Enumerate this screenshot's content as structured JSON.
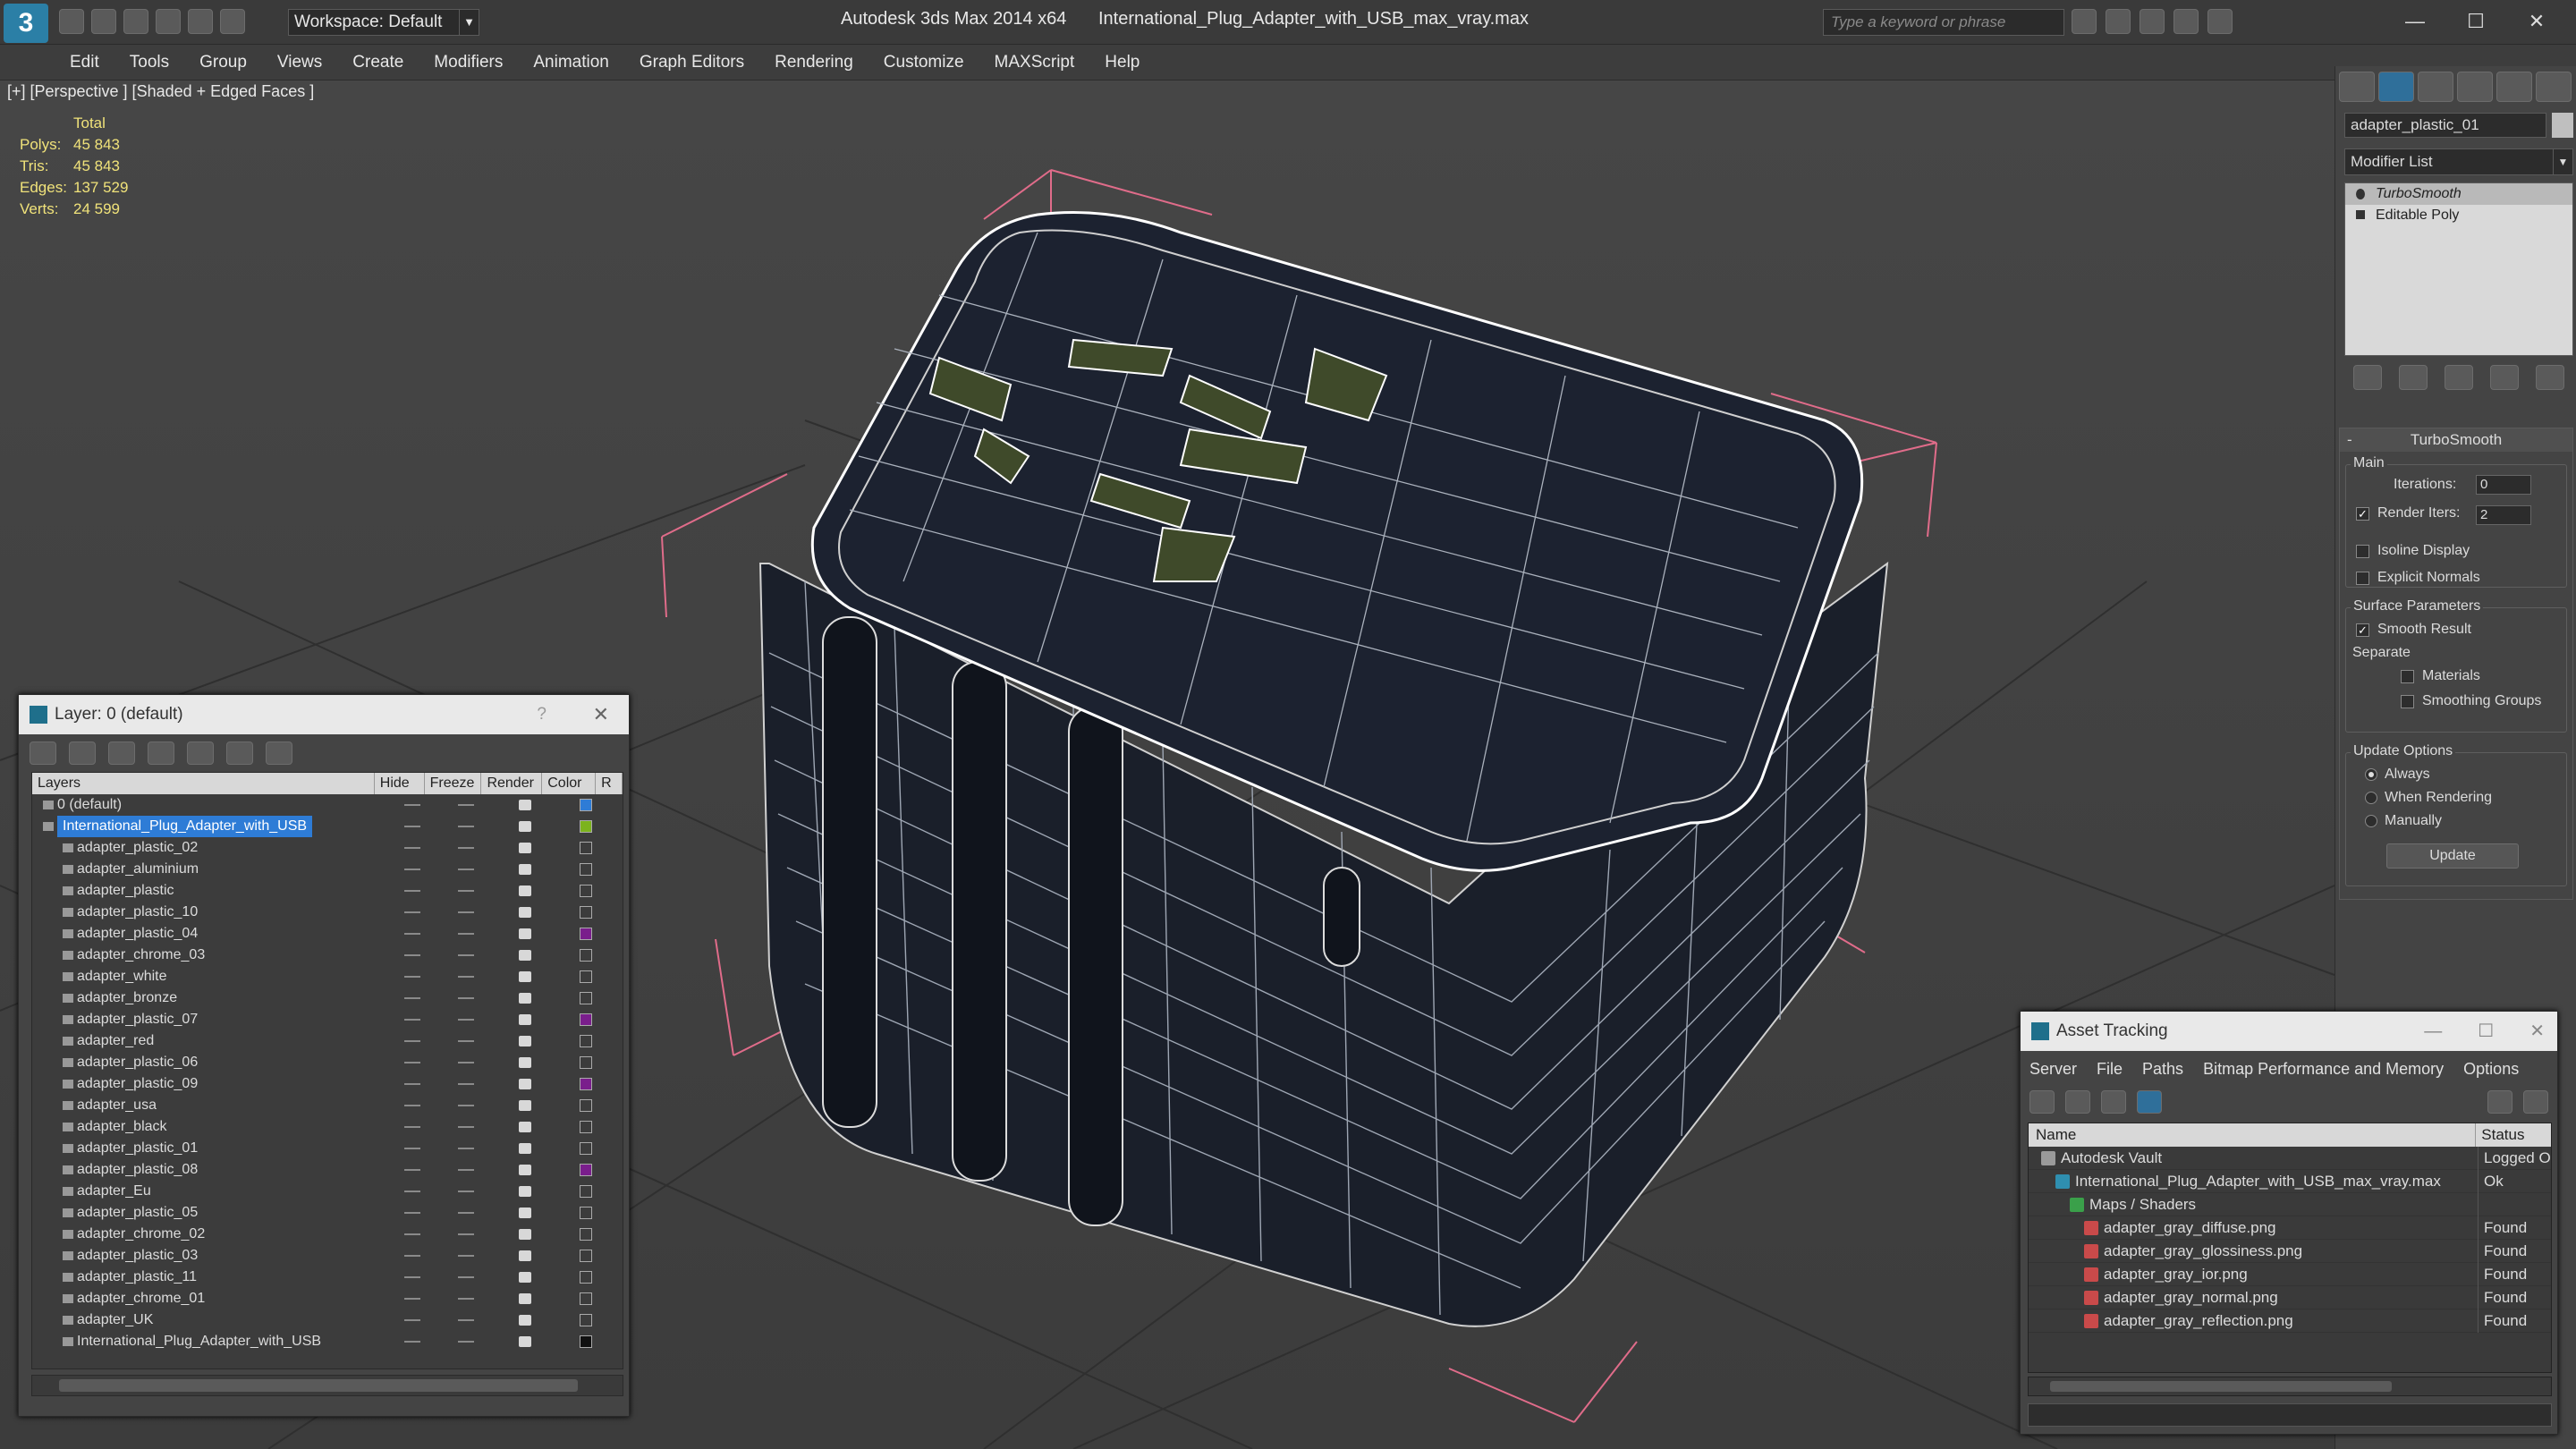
{
  "titlebar": {
    "workspace": "Workspace: Default",
    "app": "Autodesk 3ds Max  2014 x64",
    "file": "International_Plug_Adapter_with_USB_max_vray.max",
    "search_placeholder": "Type a keyword or phrase"
  },
  "menu": [
    "Edit",
    "Tools",
    "Group",
    "Views",
    "Create",
    "Modifiers",
    "Animation",
    "Graph Editors",
    "Rendering",
    "Customize",
    "MAXScript",
    "Help"
  ],
  "viewport": {
    "label": "[+] [Perspective ] [Shaded + Edged Faces ]",
    "stats": {
      "header": "Total",
      "rows": [
        {
          "k": "Polys:",
          "v": "45 843"
        },
        {
          "k": "Tris:",
          "v": "45 843"
        },
        {
          "k": "Edges:",
          "v": "137 529"
        },
        {
          "k": "Verts:",
          "v": "24 599"
        }
      ]
    }
  },
  "command_panel": {
    "object_name": "adapter_plastic_01",
    "modifier_list": "Modifier List",
    "stack": [
      "TurboSmooth",
      "Editable Poly"
    ],
    "turbosmooth": {
      "title": "TurboSmooth",
      "main": "Main",
      "iterations_label": "Iterations:",
      "iterations": "0",
      "render_iters_label": "Render Iters:",
      "render_iters": "2",
      "isoline": "Isoline Display",
      "explicit": "Explicit Normals",
      "surface": "Surface Parameters",
      "smooth_result": "Smooth Result",
      "separate": "Separate",
      "materials": "Materials",
      "smoothing_groups": "Smoothing Groups",
      "update_options": "Update Options",
      "always": "Always",
      "when_rendering": "When Rendering",
      "manually": "Manually",
      "update": "Update"
    }
  },
  "layer_window": {
    "title": "Layer: 0 (default)",
    "help": "?",
    "columns": [
      "Layers",
      "Hide",
      "Freeze",
      "Render",
      "Color",
      "R"
    ],
    "rows": [
      {
        "name": "0 (default)",
        "level": 0,
        "color": "#2e7cd6"
      },
      {
        "name": "International_Plug_Adapter_with_USB",
        "level": 0,
        "color": "#7cb31d",
        "selected": true
      },
      {
        "name": "adapter_plastic_02",
        "level": 1,
        "color": ""
      },
      {
        "name": "adapter_aluminium",
        "level": 1,
        "color": ""
      },
      {
        "name": "adapter_plastic",
        "level": 1,
        "color": ""
      },
      {
        "name": "adapter_plastic_10",
        "level": 1,
        "color": ""
      },
      {
        "name": "adapter_plastic_04",
        "level": 1,
        "color": "#7a1e8c"
      },
      {
        "name": "adapter_chrome_03",
        "level": 1,
        "color": ""
      },
      {
        "name": "adapter_white",
        "level": 1,
        "color": ""
      },
      {
        "name": "adapter_bronze",
        "level": 1,
        "color": ""
      },
      {
        "name": "adapter_plastic_07",
        "level": 1,
        "color": "#7a1e8c"
      },
      {
        "name": "adapter_red",
        "level": 1,
        "color": ""
      },
      {
        "name": "adapter_plastic_06",
        "level": 1,
        "color": ""
      },
      {
        "name": "adapter_plastic_09",
        "level": 1,
        "color": "#7a1e8c"
      },
      {
        "name": "adapter_usa",
        "level": 1,
        "color": ""
      },
      {
        "name": "adapter_black",
        "level": 1,
        "color": ""
      },
      {
        "name": "adapter_plastic_01",
        "level": 1,
        "color": ""
      },
      {
        "name": "adapter_plastic_08",
        "level": 1,
        "color": "#7a1e8c"
      },
      {
        "name": "adapter_Eu",
        "level": 1,
        "color": ""
      },
      {
        "name": "adapter_plastic_05",
        "level": 1,
        "color": ""
      },
      {
        "name": "adapter_chrome_02",
        "level": 1,
        "color": ""
      },
      {
        "name": "adapter_plastic_03",
        "level": 1,
        "color": ""
      },
      {
        "name": "adapter_plastic_11",
        "level": 1,
        "color": ""
      },
      {
        "name": "adapter_chrome_01",
        "level": 1,
        "color": ""
      },
      {
        "name": "adapter_UK",
        "level": 1,
        "color": ""
      },
      {
        "name": "International_Plug_Adapter_with_USB",
        "level": 1,
        "color": "#111111"
      }
    ]
  },
  "asset_window": {
    "title": "Asset Tracking",
    "menu": [
      "Server",
      "File",
      "Paths",
      "Bitmap Performance and Memory",
      "Options"
    ],
    "columns": [
      "Name",
      "Status"
    ],
    "rows": [
      {
        "name": "Autodesk Vault",
        "status": "Logged O",
        "level": 0,
        "icon": "vault"
      },
      {
        "name": "International_Plug_Adapter_with_USB_max_vray.max",
        "status": "Ok",
        "level": 1,
        "icon": "max"
      },
      {
        "name": "Maps / Shaders",
        "status": "",
        "level": 2,
        "icon": "maps"
      },
      {
        "name": "adapter_gray_diffuse.png",
        "status": "Found",
        "level": 3,
        "icon": "png"
      },
      {
        "name": "adapter_gray_glossiness.png",
        "status": "Found",
        "level": 3,
        "icon": "png"
      },
      {
        "name": "adapter_gray_ior.png",
        "status": "Found",
        "level": 3,
        "icon": "png"
      },
      {
        "name": "adapter_gray_normal.png",
        "status": "Found",
        "level": 3,
        "icon": "png"
      },
      {
        "name": "adapter_gray_reflection.png",
        "status": "Found",
        "level": 3,
        "icon": "png"
      }
    ]
  }
}
